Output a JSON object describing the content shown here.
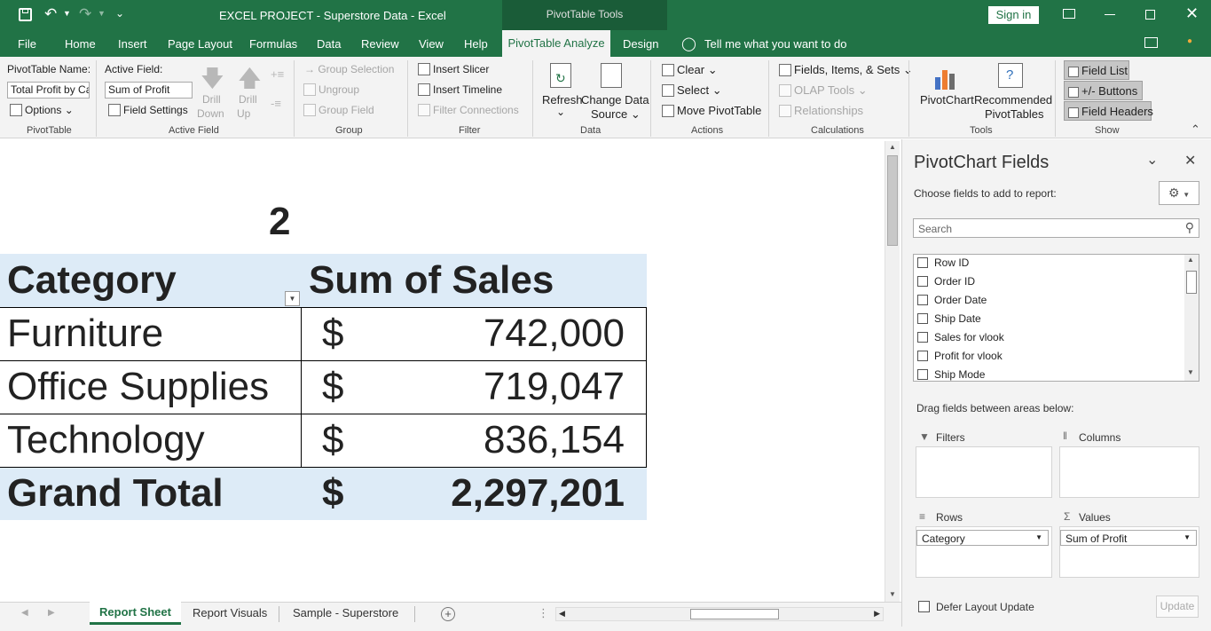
{
  "titlebar": {
    "title": "EXCEL PROJECT - Superstore Data  -  Excel",
    "context_tools": "PivotTable Tools",
    "sign_in": "Sign in"
  },
  "menu": {
    "tabs": [
      "File",
      "Home",
      "Insert",
      "Page Layout",
      "Formulas",
      "Data",
      "Review",
      "View",
      "Help",
      "PivotTable Analyze",
      "Design"
    ],
    "active": "PivotTable Analyze",
    "tell_me": "Tell me what you want to do"
  },
  "ribbon": {
    "pivottable": {
      "name_label": "PivotTable Name:",
      "name_value": "Total Profit by Category",
      "options": "Options",
      "group": "PivotTable"
    },
    "active_field": {
      "label": "Active Field:",
      "value": "Sum of Profit",
      "field_settings": "Field Settings",
      "drill_down_1": "Drill",
      "drill_down_2": "Down",
      "drill_up_1": "Drill",
      "drill_up_2": "Up",
      "group": "Active Field"
    },
    "group_grp": {
      "group_selection": "Group Selection",
      "ungroup": "Ungroup",
      "group_field": "Group Field",
      "group": "Group"
    },
    "filter": {
      "insert_slicer": "Insert Slicer",
      "insert_timeline": "Insert Timeline",
      "filter_connections": "Filter Connections",
      "group": "Filter"
    },
    "data": {
      "refresh": "Refresh",
      "change_1": "Change Data",
      "change_2": "Source",
      "group": "Data"
    },
    "actions": {
      "clear": "Clear",
      "select": "Select",
      "move": "Move PivotTable",
      "group": "Actions"
    },
    "calculations": {
      "fields_items": "Fields, Items, & Sets",
      "olap": "OLAP Tools",
      "relationships": "Relationships",
      "group": "Calculations"
    },
    "tools": {
      "pivotchart": "PivotChart",
      "recommended_1": "Recommended",
      "recommended_2": "PivotTables",
      "group": "Tools"
    },
    "show": {
      "field_list": "Field List",
      "buttons": "+/- Buttons",
      "field_headers": "Field Headers",
      "group": "Show"
    }
  },
  "sheet": {
    "heading_number": "2",
    "header_category": "Category",
    "header_sales": "Sum of Sales",
    "rows": [
      {
        "category": "Furniture",
        "currency": "$",
        "value": "742,000"
      },
      {
        "category": "Office Supplies",
        "currency": "$",
        "value": "719,047"
      },
      {
        "category": "Technology",
        "currency": "$",
        "value": "836,154"
      }
    ],
    "total": {
      "label": "Grand Total",
      "currency": "$",
      "value": "2,297,201"
    }
  },
  "sheet_tabs": {
    "tabs": [
      "Report Sheet",
      "Report Visuals",
      "Sample - Superstore"
    ],
    "active": "Report Sheet"
  },
  "pane": {
    "title": "PivotChart Fields",
    "subtitle": "Choose fields to add to report:",
    "search_placeholder": "Search",
    "fields": [
      "Row ID",
      "Order ID",
      "Order Date",
      "Ship Date",
      "Sales for vlook",
      "Profit for vlook",
      "Ship Mode"
    ],
    "drag_label": "Drag fields between areas below:",
    "areas": {
      "filters": "Filters",
      "columns": "Columns",
      "rows": "Rows",
      "values": "Values"
    },
    "rows_value": "Category",
    "values_value": "Sum of Profit",
    "defer": "Defer Layout Update",
    "update": "Update"
  }
}
